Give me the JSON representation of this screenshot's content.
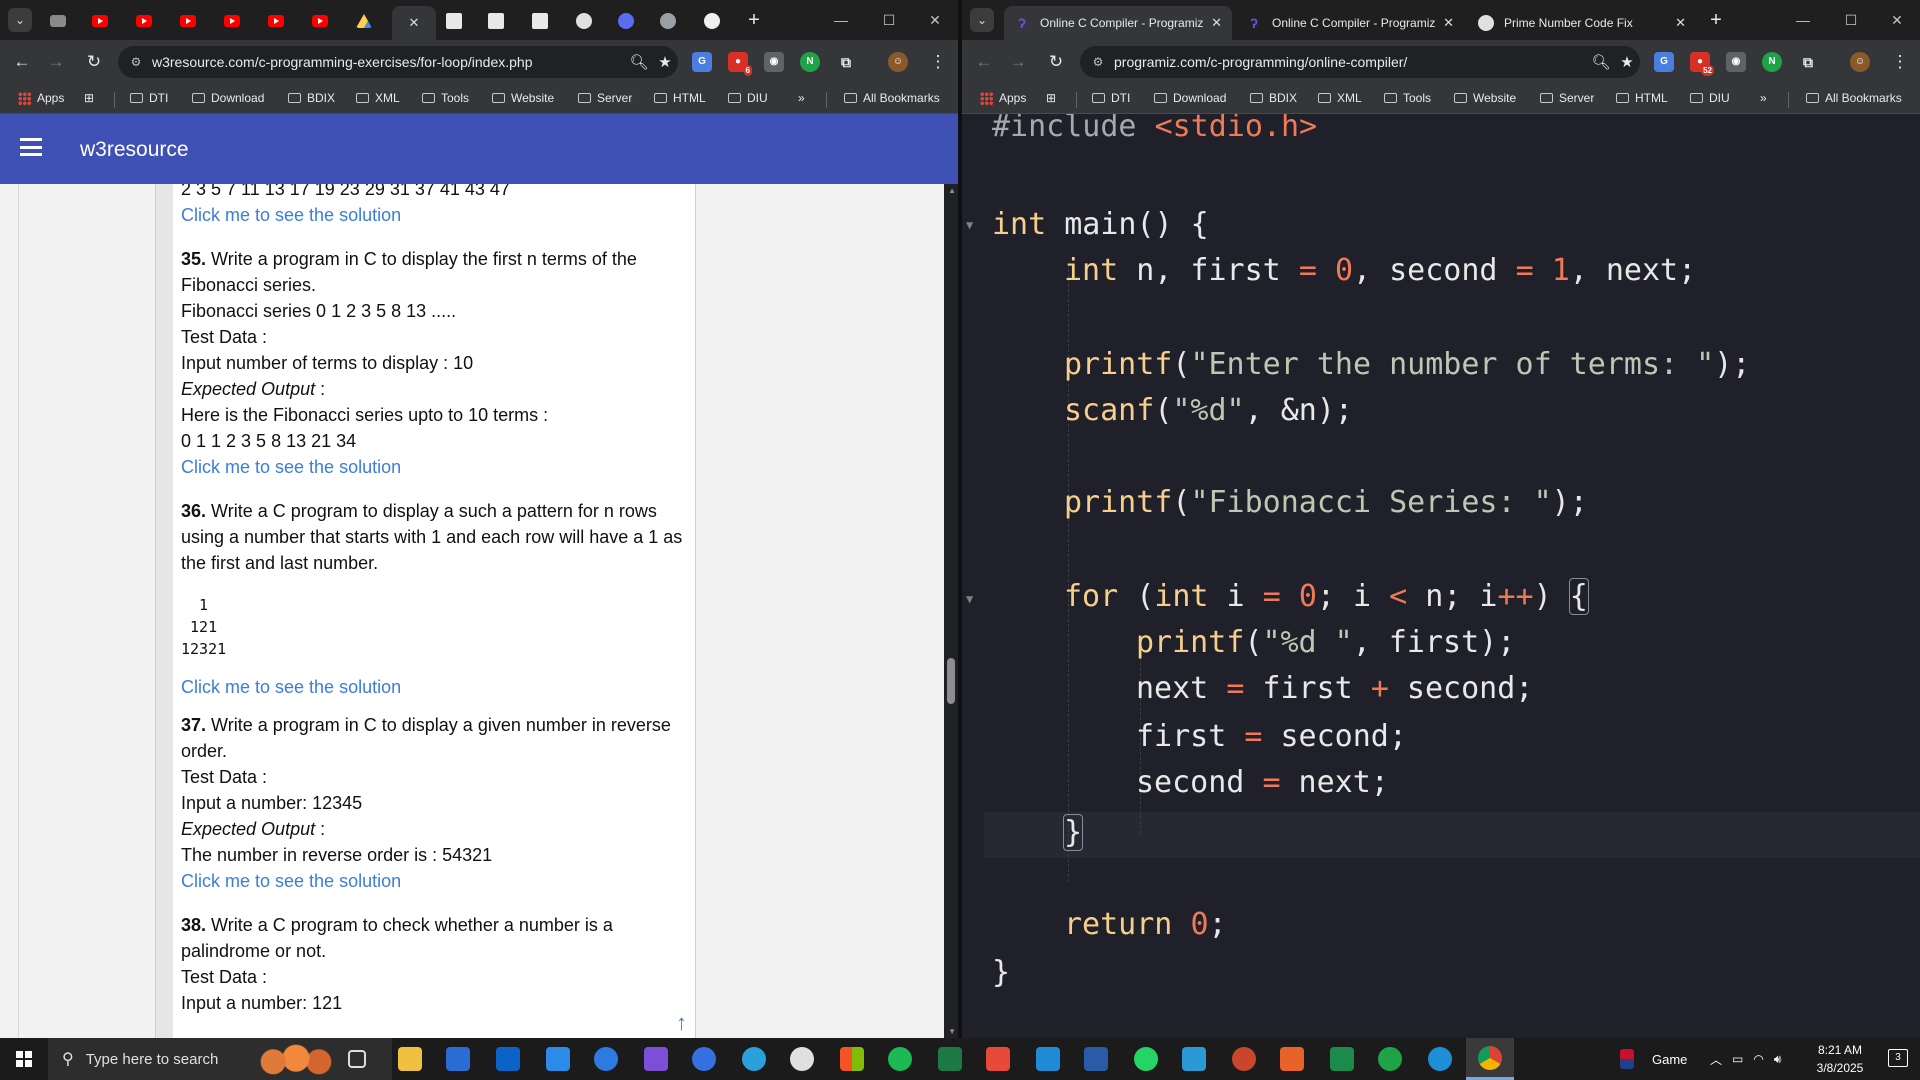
{
  "left_window": {
    "tabs_favicons": [
      "folder",
      "youtube",
      "youtube",
      "youtube",
      "youtube",
      "youtube",
      "youtube",
      "drive",
      "w3resource",
      "w3resource",
      "w3resource",
      "ai",
      "cursor",
      "globe",
      "github"
    ],
    "url": "w3resource.com/c-programming-exercises/for-loop/index.php",
    "bookmarks": {
      "apps": "Apps",
      "folders": [
        "DTI",
        "Download",
        "BDIX",
        "XML",
        "Tools",
        "Website",
        "Server",
        "HTML",
        "DIU"
      ],
      "more": "»",
      "all": "All Bookmarks"
    },
    "extension_badge": "6",
    "site": {
      "brand": "w3resource",
      "prime_output": "2 3 5 7 11 13 17 19 23 29 31 37 41 43 47",
      "solution_link": "Click me to see the solution",
      "q35": {
        "num": "35.",
        "text": "Write a program in C to display the first n terms of the Fibonacci series.",
        "line1": "Fibonacci series 0 1 2 3 5 8 13 .....",
        "test_data": "Test Data :",
        "input": "Input number of terms to display : 10",
        "expected": "Expected Output",
        "expected_colon": " :",
        "out1": "Here is the Fibonacci series upto to 10 terms :",
        "out2": "0 1 1 2 3 5 8 13 21 34"
      },
      "q36": {
        "num": "36.",
        "text": "Write a C program to display a such a pattern for n rows using a number that starts with 1 and each row will have a 1 as the first and last number.",
        "pattern": "  1\n 121\n12321"
      },
      "q37": {
        "num": "37.",
        "text": "Write a program in C to display a given number in reverse order.",
        "test_data": "Test Data :",
        "input": "Input a number: 12345",
        "expected": "Expected Output",
        "expected_colon": " :",
        "out1": "The number in reverse order is : 54321"
      },
      "q38": {
        "num": "38.",
        "text": "Write a C program to check whether a number is a palindrome or not.",
        "test_data": "Test Data :",
        "input": "Input a number: 121"
      }
    }
  },
  "right_window": {
    "tabs": [
      {
        "title": "Online C Compiler - Programiz",
        "active": true
      },
      {
        "title": "Online C Compiler - Programiz",
        "active": false
      },
      {
        "title": "Prime Number Code Fix",
        "active": false
      }
    ],
    "url": "programiz.com/c-programming/online-compiler/",
    "extension_badge": "52",
    "bookmarks": {
      "apps": "Apps",
      "folders": [
        "DTI",
        "Download",
        "BDIX",
        "XML",
        "Tools",
        "Website",
        "Server",
        "HTML",
        "DIU"
      ],
      "more": "»",
      "all": "All Bookmarks"
    },
    "code": {
      "include_kw": "#include",
      "include_hdr": "<stdio.h>",
      "l_int": "int",
      "l_main": " main() {",
      "l_decl_int": "int",
      "l_decl_1": " n, first ",
      "l_eq": "=",
      "l_zero": "0",
      "l_decl_2": ", second ",
      "l_one": "1",
      "l_decl_3": ", next;",
      "printf": "printf",
      "str_enter": "\"Enter the number of terms: \"",
      "close_semicolon": ");",
      "scanf": "scanf",
      "str_pct_d": "\"%d\"",
      "scanf_args": ", &n);",
      "str_fib": "\"Fibonacci Series: \"",
      "for_kw": "for",
      "for_open": " (",
      "for_int": "int",
      "for_i": " i ",
      "for_semi": "; i ",
      "for_lt": "<",
      "for_n": " n; i",
      "for_pp": "++",
      "for_close": ") ",
      "brace_open": "{",
      "str_pct_d_sp": "\"%d \"",
      "printf_first": ", first);",
      "next_lhs": "next ",
      "next_rhs1": " first ",
      "plus": "+",
      "next_rhs2": " second;",
      "first_lhs": "first ",
      "first_rhs": " second;",
      "second_lhs": "second ",
      "second_rhs": " next;",
      "brace_close": "}",
      "return_kw": "return",
      "return_val": "0",
      "semicolon": ";",
      "main_close": "}"
    }
  },
  "taskbar": {
    "search_placeholder": "Type here to search",
    "weather": "Game",
    "time": "8:21 AM",
    "date": "3/8/2025",
    "notification_count": "3"
  },
  "colors": {
    "w3_header": "#3f51b5",
    "w3_link": "#3b7ddd",
    "editor_bg": "#1f202a"
  }
}
